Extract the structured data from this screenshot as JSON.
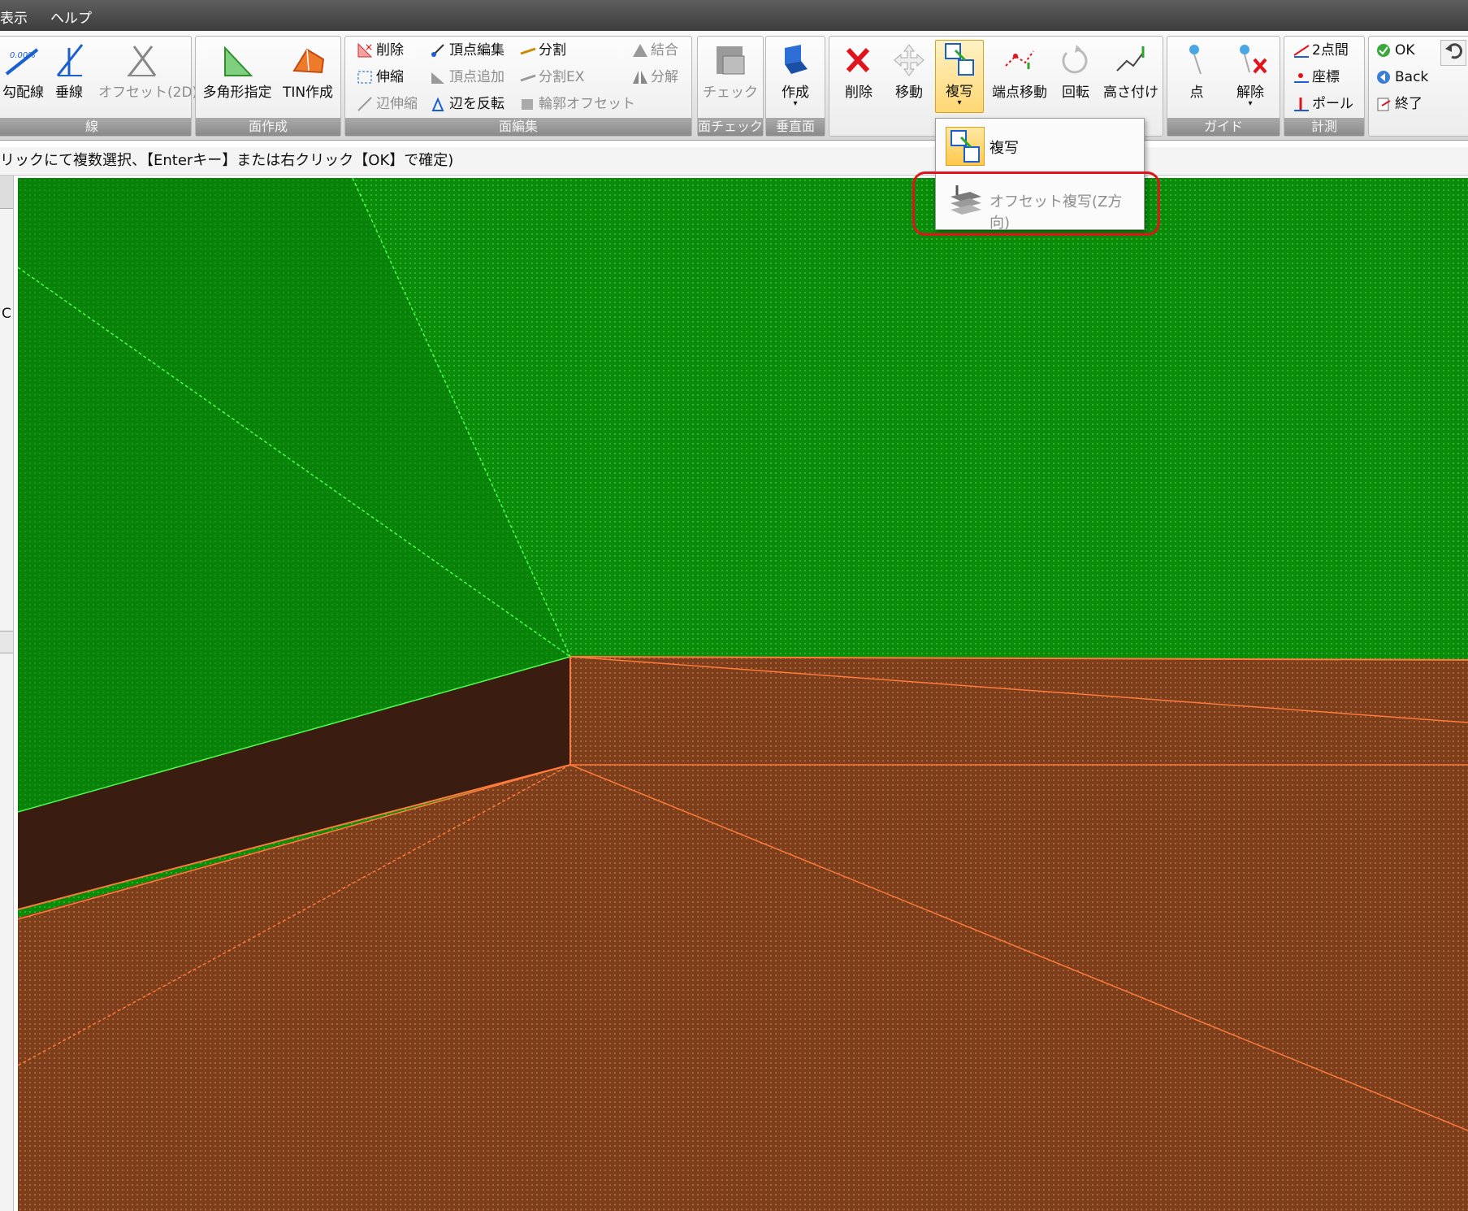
{
  "menubar": {
    "items": [
      "表示",
      "ヘルプ"
    ]
  },
  "ribbon": {
    "groups": {
      "line": {
        "label": "線",
        "buttons": [
          "勾配線",
          "垂線",
          "オフセット(2D)"
        ]
      },
      "face_create": {
        "label": "面作成",
        "buttons": [
          "多角形指定",
          "TIN作成"
        ]
      },
      "face_edit": {
        "label": "面編集",
        "buttons": [
          "削除",
          "伸縮",
          "辺伸縮",
          "頂点編集",
          "頂点追加",
          "辺を反転",
          "分割",
          "分割EX",
          "輪郭オフセット",
          "結合",
          "分解"
        ]
      },
      "face_check": {
        "label": "面チェック",
        "buttons": [
          "チェック"
        ]
      },
      "vertical_face": {
        "label": "垂直面",
        "buttons": [
          "作成"
        ]
      },
      "transform": {
        "label": "",
        "buttons": [
          "削除",
          "移動",
          "複写",
          "端点移動",
          "回転",
          "高さ付け"
        ]
      },
      "guide": {
        "label": "ガイド",
        "buttons": [
          "点",
          "解除"
        ]
      },
      "measure": {
        "label": "計測",
        "buttons": [
          "2点間",
          "座標",
          "ポール"
        ]
      },
      "confirm": {
        "buttons": [
          "OK",
          "Back",
          "終了"
        ]
      }
    }
  },
  "hint": "リックにて複数選択、【Enterキー】または右クリック【OK】で確定)",
  "left_panel": {
    "text": "C"
  },
  "dropdown": {
    "items": [
      "複写",
      "オフセット複写(Z方向)"
    ]
  },
  "colors": {
    "terrain_green": "#0a8c0a",
    "surface_brown": "#7d3f1b",
    "wall_dark": "#3a1c10",
    "edge_orange": "#ff7a3c",
    "edge_green": "#4bff4b",
    "highlight": "#e0141c"
  }
}
